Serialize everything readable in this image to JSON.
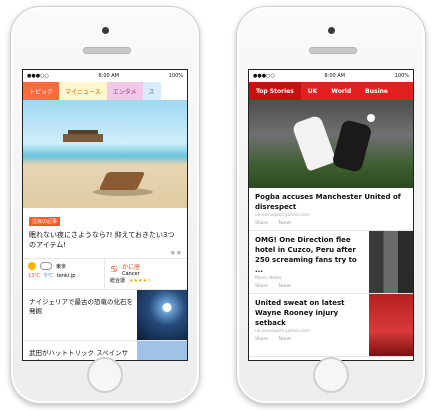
{
  "left_phone": {
    "status": {
      "carrier": "●●●○○",
      "time": "8:00 AM",
      "battery": "100%"
    },
    "tabs": [
      "トピック",
      "マイニュース",
      "エンタメ",
      "ス"
    ],
    "featured": {
      "badge": "注目の記事",
      "title": "眠れない夜にさようなら?! 抑えておきたい3つのアイテム!"
    },
    "weather": {
      "city": "東京",
      "high": "13℃",
      "low": "5℃",
      "source": "tenki.jp",
      "sign_name": "かに座",
      "sign_name_en": "Cancer",
      "fortune_label": "総合運",
      "stars": "★★★★☆"
    },
    "articles": [
      {
        "title": "ナイジェリアで最古の恐竜の化石を発掘"
      },
      {
        "title": "武田がハットトリック スペインサッカー"
      }
    ]
  },
  "right_phone": {
    "status": {
      "carrier": "●●●○○",
      "time": "8:00 AM",
      "battery": "100%"
    },
    "tabs": [
      "Top Stories",
      "UK",
      "World",
      "Busine"
    ],
    "main_story": {
      "headline": "Pogba accuses Manchester United of disrespect",
      "source": "uk.eurosport.yahoo.com",
      "share": "Share",
      "tweet": "Tweet"
    },
    "stories": [
      {
        "headline": "OMG! One Direction flee hotel in Cuzco, Peru after 250 screaming fans try to ...",
        "source": "Music News"
      },
      {
        "headline": "United sweat on latest Wayne Rooney injury setback",
        "source": "uk.eurosport.yahoo.com"
      }
    ]
  },
  "colors": {
    "left_accent": "#ff6a3d",
    "right_accent": "#e31f1f"
  }
}
